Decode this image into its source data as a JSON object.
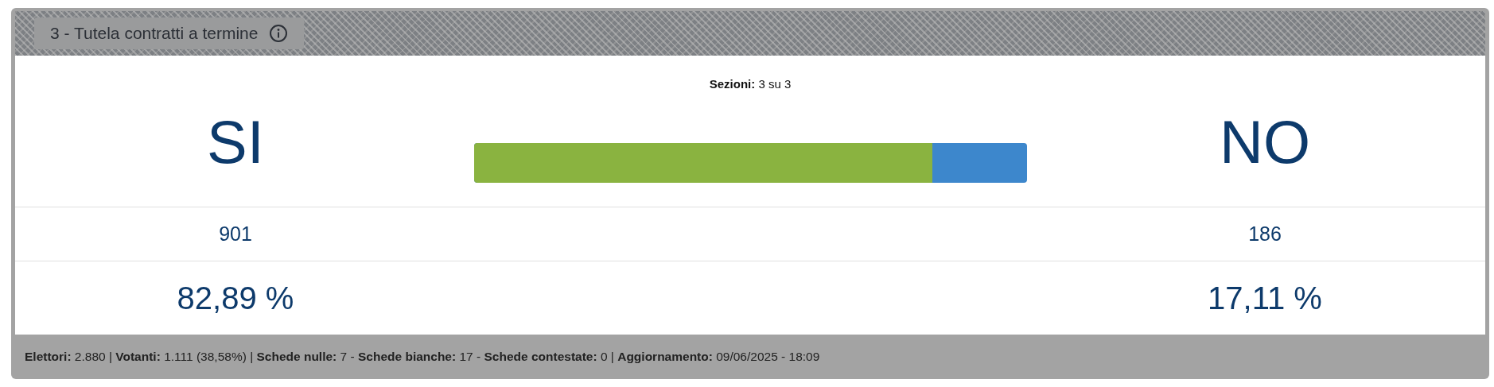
{
  "title": "3 - Tutela contratti a termine",
  "sections": "**Sezioni:** 3 su 3",
  "bar": {
    "level": 0.8289
  },
  "options": [
    {
      "label": "SI",
      "count": "901",
      "percent": "82,89 %"
    },
    {
      "label": "NO",
      "count": "186",
      "percent": "17,11 %"
    }
  ],
  "footer": "**Elettori:** 2.880 | **Votanti:** 1.111 (38,58%) | **Schede nulle:** 7 - **Schede bianche:** 17 - **Schede contestate:** 0 | **Aggiornamento:** 09/06/2025 - 18:09"
}
